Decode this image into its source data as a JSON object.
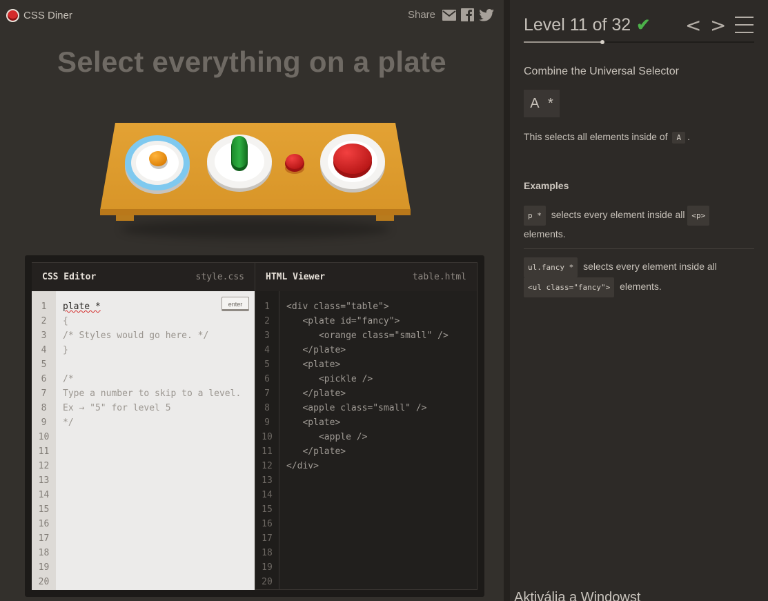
{
  "app": {
    "name": "CSS Diner"
  },
  "share": {
    "label": "Share",
    "icons": [
      "email-icon",
      "facebook-icon",
      "twitter-icon"
    ]
  },
  "headline": "Select everything on a plate",
  "table_scene": {
    "items": [
      "plate-with-orange",
      "plate-with-pickle",
      "small-apple",
      "plate-with-apple"
    ]
  },
  "css_editor": {
    "title": "CSS Editor",
    "file": "style.css",
    "enter_label": "enter",
    "input_value": "plate *",
    "lines": [
      "{",
      "/* Styles would go here. */",
      "}",
      "",
      "/*",
      "Type a number to skip to a level.",
      "Ex → \"5\" for level 5",
      "*/"
    ],
    "line_numbers": [
      "1",
      "2",
      "3",
      "4",
      "5",
      "6",
      "7",
      "8",
      "9",
      "10",
      "11",
      "12",
      "13",
      "14",
      "15",
      "16",
      "17",
      "18",
      "19",
      "20"
    ]
  },
  "html_viewer": {
    "title": "HTML Viewer",
    "file": "table.html",
    "lines": [
      "<div class=\"table\">",
      "   <plate id=\"fancy\">",
      "      <orange class=\"small\" />",
      "   </plate>",
      "   <plate>",
      "      <pickle />",
      "   </plate>",
      "   <apple class=\"small\" />",
      "   <plate>",
      "      <apple />",
      "   </plate>",
      "</div>"
    ],
    "line_numbers": [
      "1",
      "2",
      "3",
      "4",
      "5",
      "6",
      "7",
      "8",
      "9",
      "10",
      "11",
      "12",
      "13",
      "14",
      "15",
      "16",
      "17",
      "18",
      "19",
      "20"
    ]
  },
  "level": {
    "title": "Level 11 of 32",
    "completed": true,
    "progress_fraction": 0.34
  },
  "lesson": {
    "selector_name": "Combine the Universal Selector",
    "syntax": "A *",
    "hint_prefix": "This selects all elements inside of",
    "hint_code": "A",
    "hint_suffix": ".",
    "examples_heading": "Examples",
    "examples": [
      {
        "code": "p *",
        "text": "selects every element inside all",
        "code2": "<p>",
        "text2": "elements."
      },
      {
        "code": "ul.fancy *",
        "text": "selects every element inside all",
        "code2": "<ul class=\"fancy\">",
        "text2": "elements."
      }
    ]
  },
  "overlay": {
    "watermark": "Aktiválja a Windowst"
  },
  "colors": {
    "accent_check": "#4cb04a",
    "logo_red": "#d42b2b",
    "table": "#d99a2e"
  }
}
